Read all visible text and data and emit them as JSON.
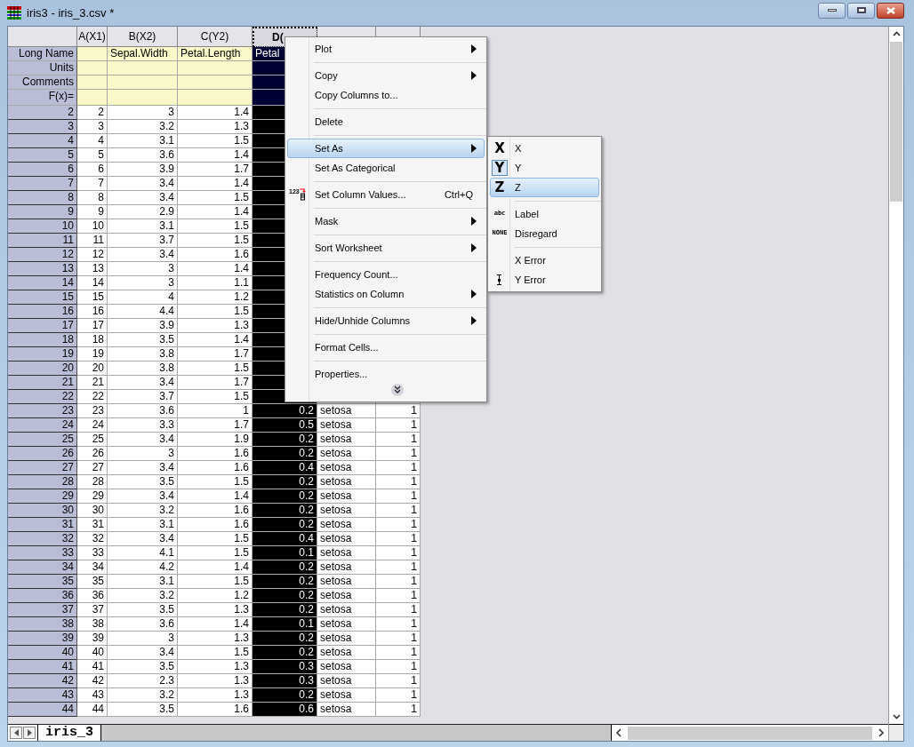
{
  "window": {
    "title": "iris3 - iris_3.csv *"
  },
  "columns": [
    {
      "name": "A(X1)",
      "kind": "number",
      "selected": false
    },
    {
      "name": "B(X2)",
      "kind": "number",
      "long_name": "Sepal.Width",
      "selected": false
    },
    {
      "name": "C(Y2)",
      "kind": "number",
      "long_name": "Petal.Length",
      "selected": false
    },
    {
      "name": "D(",
      "kind": "number",
      "long_name": "Petal",
      "selected": true
    },
    {
      "kind": "text",
      "selected": false
    },
    {
      "kind": "number",
      "selected": false
    }
  ],
  "label_rows": [
    "Long Name",
    "Units",
    "Comments",
    "F(x)="
  ],
  "rows": [
    {
      "header": "2",
      "cells": [
        "2",
        "3",
        "1.4"
      ]
    },
    {
      "header": "3",
      "cells": [
        "3",
        "3.2",
        "1.3"
      ]
    },
    {
      "header": "4",
      "cells": [
        "4",
        "3.1",
        "1.5"
      ]
    },
    {
      "header": "5",
      "cells": [
        "5",
        "3.6",
        "1.4"
      ]
    },
    {
      "header": "6",
      "cells": [
        "6",
        "3.9",
        "1.7"
      ]
    },
    {
      "header": "7",
      "cells": [
        "7",
        "3.4",
        "1.4"
      ]
    },
    {
      "header": "8",
      "cells": [
        "8",
        "3.4",
        "1.5"
      ]
    },
    {
      "header": "9",
      "cells": [
        "9",
        "2.9",
        "1.4"
      ]
    },
    {
      "header": "10",
      "cells": [
        "10",
        "3.1",
        "1.5"
      ]
    },
    {
      "header": "11",
      "cells": [
        "11",
        "3.7",
        "1.5"
      ]
    },
    {
      "header": "12",
      "cells": [
        "12",
        "3.4",
        "1.6"
      ]
    },
    {
      "header": "13",
      "cells": [
        "13",
        "3",
        "1.4"
      ]
    },
    {
      "header": "14",
      "cells": [
        "14",
        "3",
        "1.1"
      ]
    },
    {
      "header": "15",
      "cells": [
        "15",
        "4",
        "1.2"
      ]
    },
    {
      "header": "16",
      "cells": [
        "16",
        "4.4",
        "1.5"
      ]
    },
    {
      "header": "17",
      "cells": [
        "17",
        "3.9",
        "1.3"
      ]
    },
    {
      "header": "18",
      "cells": [
        "18",
        "3.5",
        "1.4"
      ]
    },
    {
      "header": "19",
      "cells": [
        "19",
        "3.8",
        "1.7"
      ]
    },
    {
      "header": "20",
      "cells": [
        "20",
        "3.8",
        "1.5"
      ]
    },
    {
      "header": "21",
      "cells": [
        "21",
        "3.4",
        "1.7"
      ]
    },
    {
      "header": "22",
      "cells": [
        "22",
        "3.7",
        "1.5"
      ]
    },
    {
      "header": "23",
      "cells": [
        "23",
        "3.6",
        "1",
        "0.2",
        "setosa",
        "1"
      ]
    },
    {
      "header": "24",
      "cells": [
        "24",
        "3.3",
        "1.7",
        "0.5",
        "setosa",
        "1"
      ]
    },
    {
      "header": "25",
      "cells": [
        "25",
        "3.4",
        "1.9",
        "0.2",
        "setosa",
        "1"
      ]
    },
    {
      "header": "26",
      "cells": [
        "26",
        "3",
        "1.6",
        "0.2",
        "setosa",
        "1"
      ]
    },
    {
      "header": "27",
      "cells": [
        "27",
        "3.4",
        "1.6",
        "0.4",
        "setosa",
        "1"
      ]
    },
    {
      "header": "28",
      "cells": [
        "28",
        "3.5",
        "1.5",
        "0.2",
        "setosa",
        "1"
      ]
    },
    {
      "header": "29",
      "cells": [
        "29",
        "3.4",
        "1.4",
        "0.2",
        "setosa",
        "1"
      ]
    },
    {
      "header": "30",
      "cells": [
        "30",
        "3.2",
        "1.6",
        "0.2",
        "setosa",
        "1"
      ]
    },
    {
      "header": "31",
      "cells": [
        "31",
        "3.1",
        "1.6",
        "0.2",
        "setosa",
        "1"
      ]
    },
    {
      "header": "32",
      "cells": [
        "32",
        "3.4",
        "1.5",
        "0.4",
        "setosa",
        "1"
      ]
    },
    {
      "header": "33",
      "cells": [
        "33",
        "4.1",
        "1.5",
        "0.1",
        "setosa",
        "1"
      ]
    },
    {
      "header": "34",
      "cells": [
        "34",
        "4.2",
        "1.4",
        "0.2",
        "setosa",
        "1"
      ]
    },
    {
      "header": "35",
      "cells": [
        "35",
        "3.1",
        "1.5",
        "0.2",
        "setosa",
        "1"
      ]
    },
    {
      "header": "36",
      "cells": [
        "36",
        "3.2",
        "1.2",
        "0.2",
        "setosa",
        "1"
      ]
    },
    {
      "header": "37",
      "cells": [
        "37",
        "3.5",
        "1.3",
        "0.2",
        "setosa",
        "1"
      ]
    },
    {
      "header": "38",
      "cells": [
        "38",
        "3.6",
        "1.4",
        "0.1",
        "setosa",
        "1"
      ]
    },
    {
      "header": "39",
      "cells": [
        "39",
        "3",
        "1.3",
        "0.2",
        "setosa",
        "1"
      ]
    },
    {
      "header": "40",
      "cells": [
        "40",
        "3.4",
        "1.5",
        "0.2",
        "setosa",
        "1"
      ]
    },
    {
      "header": "41",
      "cells": [
        "41",
        "3.5",
        "1.3",
        "0.3",
        "setosa",
        "1"
      ]
    },
    {
      "header": "42",
      "cells": [
        "42",
        "2.3",
        "1.3",
        "0.3",
        "setosa",
        "1"
      ]
    },
    {
      "header": "43",
      "cells": [
        "43",
        "3.2",
        "1.3",
        "0.2",
        "setosa",
        "1"
      ]
    },
    {
      "header": "44",
      "cells": [
        "44",
        "3.5",
        "1.6",
        "0.6",
        "setosa",
        "1"
      ]
    }
  ],
  "sheet_tabs": [
    {
      "label": "iris_3",
      "selected": true
    }
  ],
  "context_menu": [
    {
      "kind": "item",
      "label": "Plot",
      "submenu": true,
      "highlighted": false
    },
    {
      "kind": "separator"
    },
    {
      "kind": "item",
      "label": "Copy",
      "submenu": true,
      "highlighted": false
    },
    {
      "kind": "item",
      "label": "Copy Columns to...",
      "submenu": false,
      "highlighted": false
    },
    {
      "kind": "separator"
    },
    {
      "kind": "item",
      "label": "Delete",
      "submenu": false,
      "highlighted": false
    },
    {
      "kind": "separator"
    },
    {
      "kind": "item",
      "label": "Set As",
      "submenu": true,
      "highlighted": true
    },
    {
      "kind": "item",
      "label": "Set As Categorical",
      "submenu": false,
      "highlighted": false
    },
    {
      "kind": "separator"
    },
    {
      "kind": "item",
      "label": "Set Column Values...",
      "shortcut": "Ctrl+Q",
      "icon_text": "123",
      "submenu": false,
      "highlighted": false
    },
    {
      "kind": "separator"
    },
    {
      "kind": "item",
      "label": "Mask",
      "submenu": true,
      "highlighted": false
    },
    {
      "kind": "separator"
    },
    {
      "kind": "item",
      "label": "Sort Worksheet",
      "submenu": true,
      "highlighted": false
    },
    {
      "kind": "separator"
    },
    {
      "kind": "item",
      "label": "Frequency Count...",
      "submenu": false,
      "highlighted": false
    },
    {
      "kind": "item",
      "label": "Statistics on Column",
      "submenu": true,
      "highlighted": false
    },
    {
      "kind": "separator"
    },
    {
      "kind": "item",
      "label": "Hide/Unhide Columns",
      "submenu": true,
      "highlighted": false
    },
    {
      "kind": "separator"
    },
    {
      "kind": "item",
      "label": "Format Cells...",
      "submenu": false,
      "highlighted": false
    },
    {
      "kind": "separator"
    },
    {
      "kind": "item",
      "label": "Properties...",
      "submenu": false,
      "highlighted": false
    },
    {
      "kind": "expand"
    }
  ],
  "submenu": [
    {
      "kind": "item",
      "label": "X",
      "glyph": "X",
      "checked": false,
      "highlighted": false
    },
    {
      "kind": "item",
      "label": "Y",
      "glyph": "Y",
      "checked": true,
      "highlighted": false
    },
    {
      "kind": "item",
      "label": "Z",
      "glyph": "Z",
      "checked": false,
      "highlighted": true
    },
    {
      "kind": "separator"
    },
    {
      "kind": "item",
      "label": "Label",
      "small_glyph": "abc",
      "highlighted": false
    },
    {
      "kind": "item",
      "label": "Disregard",
      "small_glyph": "NONE",
      "highlighted": false
    },
    {
      "kind": "separator"
    },
    {
      "kind": "item",
      "label": "X Error",
      "highlighted": false
    },
    {
      "kind": "item",
      "label": "Y Error",
      "error_icon": true,
      "highlighted": false
    }
  ]
}
